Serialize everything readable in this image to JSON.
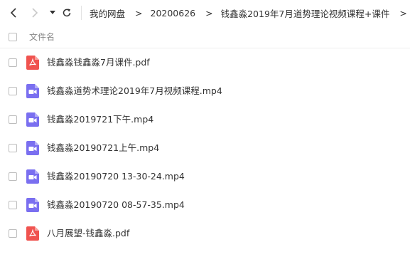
{
  "toolbar": {
    "back_icon": "chevron-left-icon",
    "forward_icon": "chevron-right-icon",
    "dropdown_icon": "caret-down-icon",
    "refresh_icon": "refresh-icon"
  },
  "breadcrumb": {
    "items": [
      {
        "label": "我的网盘"
      },
      {
        "label": "20200626"
      },
      {
        "label": "钱鑫淼2019年7月道势理论视频课程+课件"
      }
    ],
    "separator": ">"
  },
  "list_header": {
    "column_name": "文件名"
  },
  "files": [
    {
      "name": "钱鑫淼钱鑫淼7月课件.pdf",
      "type": "pdf"
    },
    {
      "name": "钱鑫淼道势术理论2019年7月视频课程.mp4",
      "type": "video"
    },
    {
      "name": "钱鑫淼2019721下午.mp4",
      "type": "video"
    },
    {
      "name": "钱鑫淼20190721上午.mp4",
      "type": "video"
    },
    {
      "name": "钱鑫淼20190720 13-30-24.mp4",
      "type": "video"
    },
    {
      "name": "钱鑫淼20190720 08-57-35.mp4",
      "type": "video"
    },
    {
      "name": "八月展望-钱鑫淼.pdf",
      "type": "pdf"
    }
  ],
  "colors": {
    "pdf_icon": "#f0534f",
    "video_icon": "#7a6ff0",
    "nav_active": "#333333",
    "nav_disabled": "#c8c8c8"
  }
}
